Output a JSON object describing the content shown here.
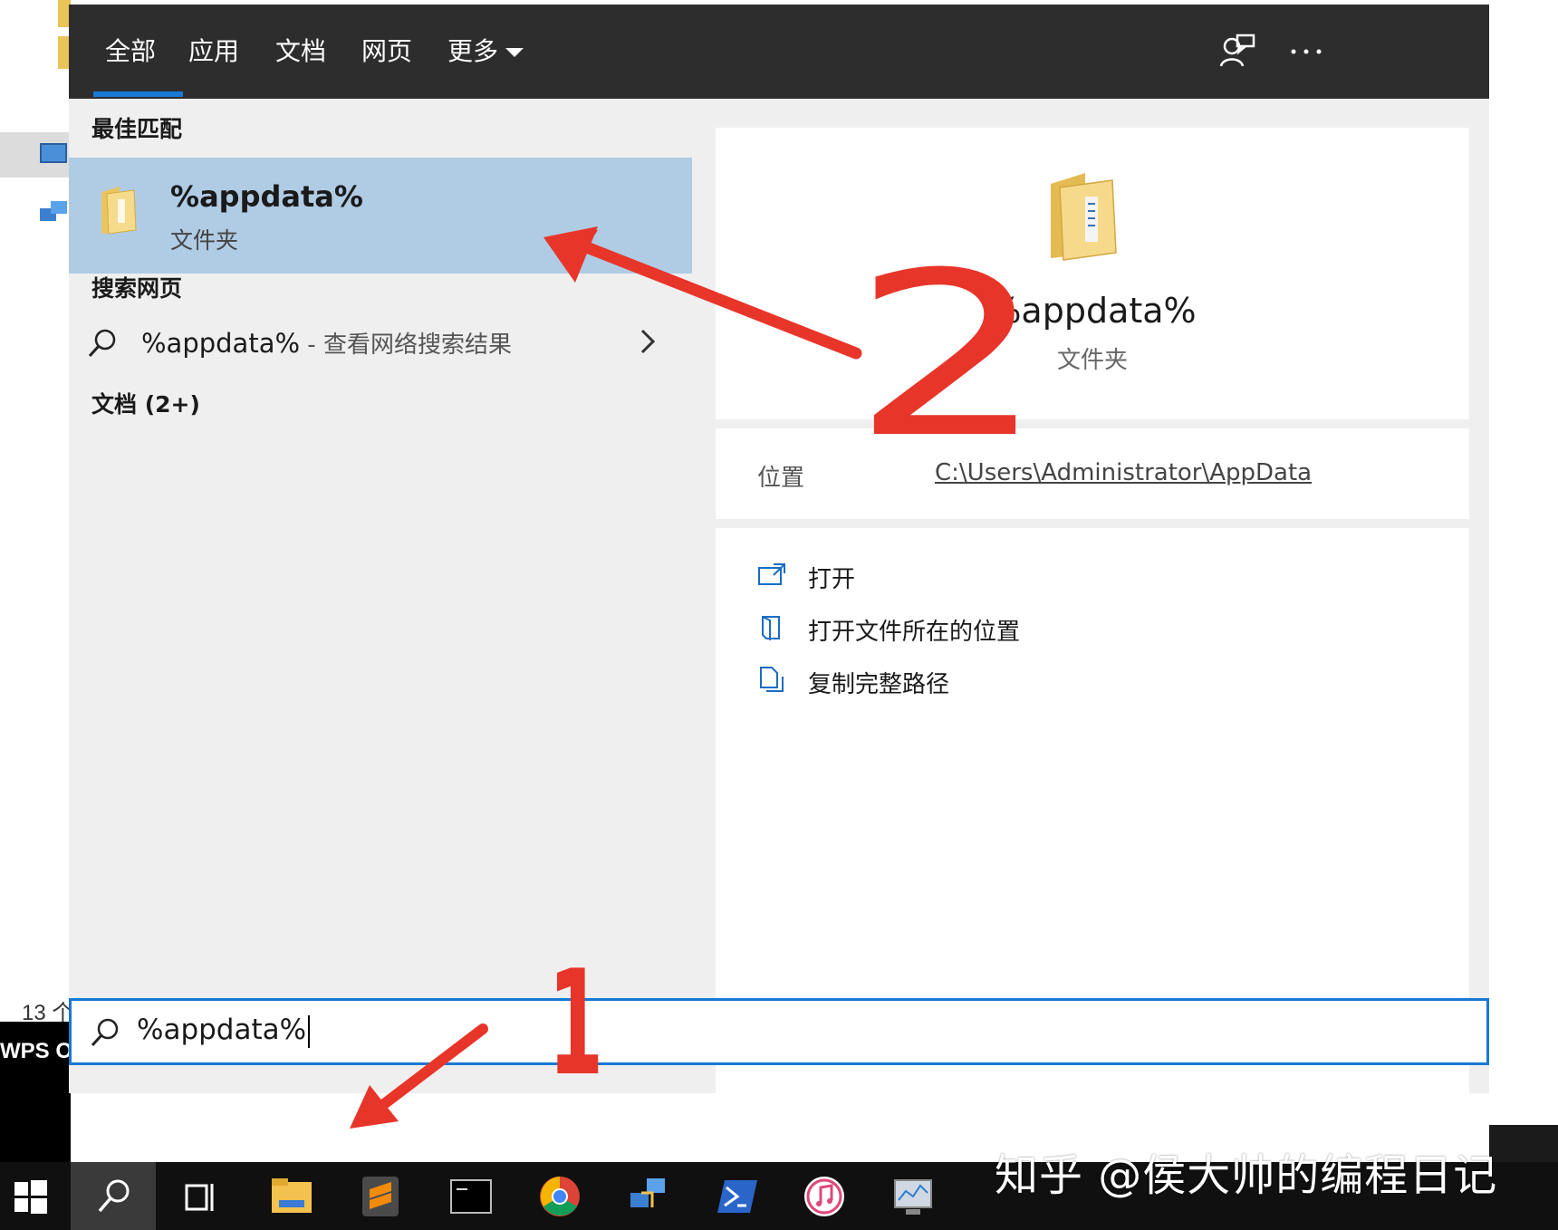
{
  "tabs": [
    {
      "label": "全部"
    },
    {
      "label": "应用"
    },
    {
      "label": "文档"
    },
    {
      "label": "网页"
    },
    {
      "label": "更多"
    }
  ],
  "left": {
    "best_match_header": "最佳匹配",
    "best_match": {
      "title": "%appdata%",
      "subtitle": "文件夹"
    },
    "web_header": "搜索网页",
    "web_result": {
      "query": "%appdata%",
      "suffix": " - 查看网络搜索结果"
    },
    "docs_header": "文档 (2+)"
  },
  "preview": {
    "title": "%appdata%",
    "subtitle": "文件夹",
    "location_label": "位置",
    "location_value": "C:\\Users\\Administrator\\AppData",
    "actions": [
      {
        "label": "打开",
        "icon": "open-icon"
      },
      {
        "label": "打开文件所在的位置",
        "icon": "file-location-icon"
      },
      {
        "label": "复制完整路径",
        "icon": "copy-icon"
      }
    ]
  },
  "search": {
    "value": "%appdata%"
  },
  "desktop": {
    "count_text": "13 个",
    "app_text": "WPS Of"
  },
  "annotations": {
    "label_1": "1",
    "label_2": "2"
  },
  "watermark": "知乎 @侯大帅的编程日记",
  "colors": {
    "accent": "#1a78d6",
    "selected": "#b0cbe4",
    "topbar": "#2d2d2d",
    "arrow": "#e8352a"
  }
}
